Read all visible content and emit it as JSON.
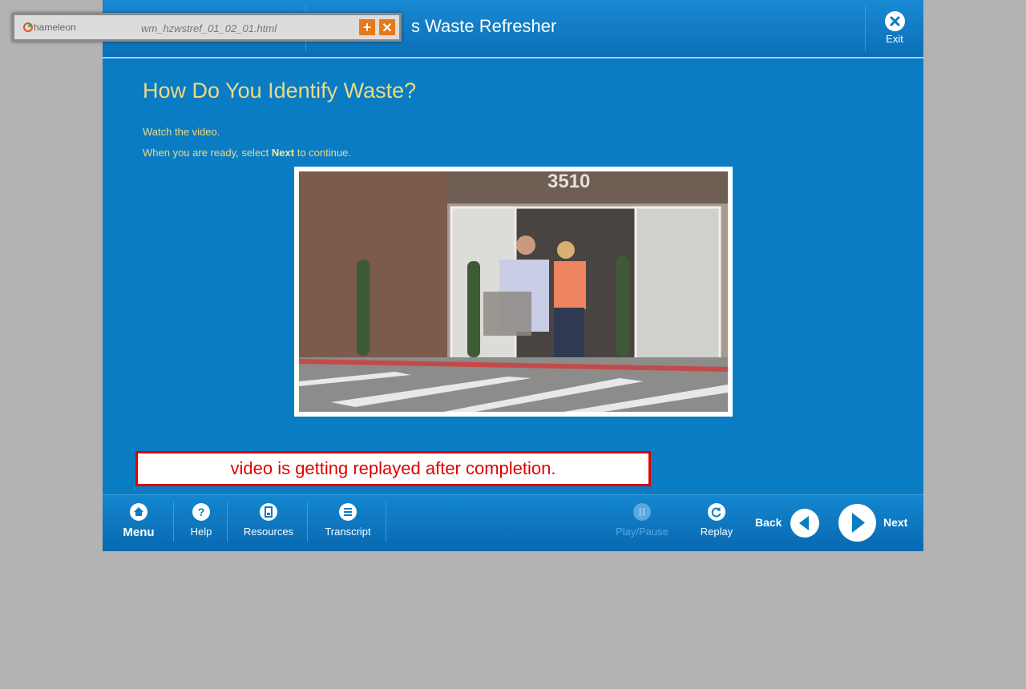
{
  "overlay": {
    "logo_text": "hameleon",
    "filename": "wm_hzwstref_01_02_01.html",
    "add_icon": "plus-icon",
    "close_icon": "close-icon",
    "accent": "#e8781a"
  },
  "header": {
    "course_title": "s Waste Refresher",
    "exit_label": "Exit",
    "exit_icon": "close-circle-icon"
  },
  "content": {
    "title": "How Do You Identify Waste?",
    "line1": "Watch the video.",
    "line2_pre": "When you are ready, select ",
    "line2_bold": "Next",
    "line2_post": " to continue.",
    "video_sign": "3510"
  },
  "annotation": "video is getting replayed after completion.",
  "footer": {
    "menu_label": "Menu",
    "help_label": "Help",
    "resources_label": "Resources",
    "transcript_label": "Transcript",
    "playpause_label": "Play/Pause",
    "replay_label": "Replay",
    "back_label": "Back",
    "next_label": "Next"
  },
  "colors": {
    "app_bg": "#0a7cc4",
    "title_gold": "#f0d97e",
    "annotation_red": "#e00000"
  }
}
